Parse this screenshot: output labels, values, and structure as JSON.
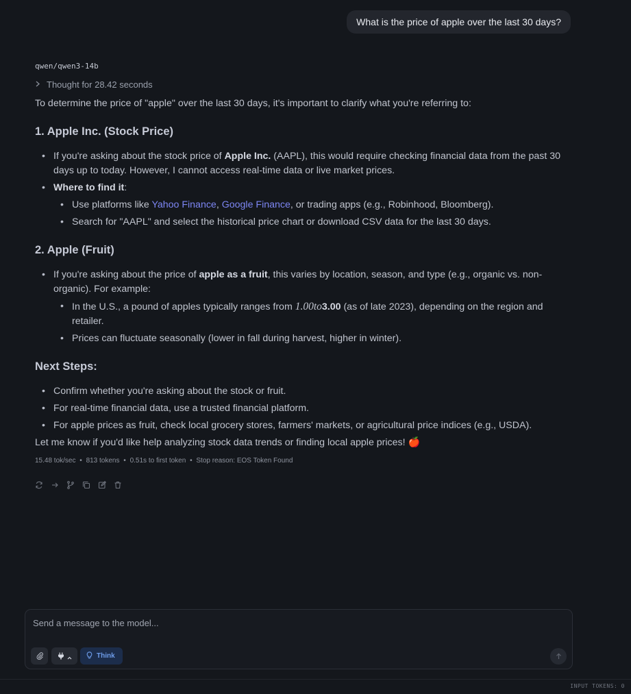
{
  "user_message": "What is the price of apple over the last 30 days?",
  "model_name": "qwen/qwen3-14b",
  "thought_label": "Thought for 28.42 seconds",
  "intro": "To determine the price of \"apple\" over the last 30 days, it's important to clarify what you're referring to:",
  "section1": {
    "heading": "1. Apple Inc. (Stock Price)",
    "item1_pre": "If you're asking about the stock price of ",
    "item1_bold": "Apple Inc.",
    "item1_post": " (AAPL), this would require checking financial data from the past 30 days up to today. However, I cannot access real-time data or live market prices.",
    "item2_bold": "Where to find it",
    "item2_post": ":",
    "sub1_pre": "Use platforms like ",
    "sub1_link1": "Yahoo Finance",
    "sub1_mid": ", ",
    "sub1_link2": "Google Finance",
    "sub1_post": ", or trading apps (e.g., Robinhood, Bloomberg).",
    "sub2": "Search for \"AAPL\" and select the historical price chart or download CSV data for the last 30 days."
  },
  "section2": {
    "heading": "2. Apple (Fruit)",
    "item1_pre": "If you're asking about the price of ",
    "item1_bold": "apple as a fruit",
    "item1_post": ", this varies by location, season, and type (e.g., organic vs. non-organic). For example:",
    "sub1_pre": "In the U.S., a pound of apples typically ranges from ",
    "sub1_math": "1.00to",
    "sub1_bold": "3.00",
    "sub1_post": " (as of late 2023), depending on the region and retailer.",
    "sub2": "Prices can fluctuate seasonally (lower in fall during harvest, higher in winter)."
  },
  "section3": {
    "heading": "Next Steps:",
    "items": [
      "Confirm whether you're asking about the stock or fruit.",
      "For real-time financial data, use a trusted financial platform.",
      "For apple prices as fruit, check local grocery stores, farmers' markets, or agricultural price indices (e.g., USDA)."
    ]
  },
  "closing": "Let me know if you'd like help analyzing stock data trends or finding local apple prices! 🍎",
  "stats": {
    "speed": "15.48 tok/sec",
    "tokens": "813 tokens",
    "ttft": "0.51s to first token",
    "stop": "Stop reason: EOS Token Found",
    "separator": "•"
  },
  "actions": [
    "regenerate-icon",
    "continue-icon",
    "branch-icon",
    "copy-icon",
    "edit-icon",
    "delete-icon"
  ],
  "composer": {
    "placeholder": "Send a message to the model...",
    "think_label": "Think"
  },
  "footer": {
    "input_tokens": "INPUT TOKENS: 0"
  },
  "colors": {
    "background": "#14171c",
    "link": "#7d86f3",
    "think_accent": "#6e9dea"
  }
}
